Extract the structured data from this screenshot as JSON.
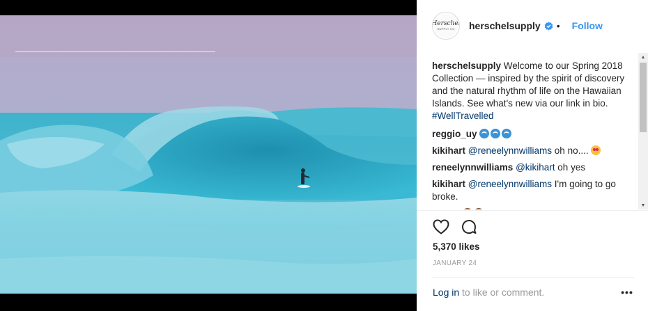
{
  "post": {
    "account": {
      "username": "herschelsupply",
      "verified": true,
      "follow_label": "Follow",
      "separator": "•",
      "avatar_logo_text": "Herschel",
      "avatar_logo_sub": "SUPPLY CO"
    },
    "caption": {
      "user": "herschelsupply",
      "text": " Welcome to our Spring 2018 Collection — inspired by the spirit of discovery and the natural rhythm of life on the Hawaiian Islands. See what's new via our link in bio. ",
      "hashtag": "#WellTravelled"
    },
    "comments": [
      {
        "user": "reggio_uy",
        "mention": "",
        "text": " ",
        "emoji": "wave-emoji x3"
      },
      {
        "user": "kikihart",
        "mention": "@reneelynnwilliams",
        "text": " oh no.... ",
        "emoji": "heart-eyes-emoji"
      },
      {
        "user": "reneelynnwilliams",
        "mention": "@kikihart",
        "text": " oh yes",
        "emoji": ""
      },
      {
        "user": "kikihart",
        "mention": "@reneelynnwilliams",
        "text": " I'm going to go broke.",
        "emoji": ""
      },
      {
        "user": "alibuff",
        "mention": "",
        "text": "",
        "emoji": "face-emoji x2"
      }
    ],
    "likes": "5,370 likes",
    "date": "JANUARY 24",
    "footer": {
      "login_label": "Log in",
      "suffix": " to like or comment.",
      "more_label": "•••"
    },
    "icons": [
      "heart-icon",
      "comment-icon",
      "verified-badge-icon",
      "more-options-icon"
    ],
    "colors": {
      "link_blue": "#3897f0",
      "mention_blue": "#003569",
      "text": "#262626",
      "muted": "#999999"
    }
  }
}
